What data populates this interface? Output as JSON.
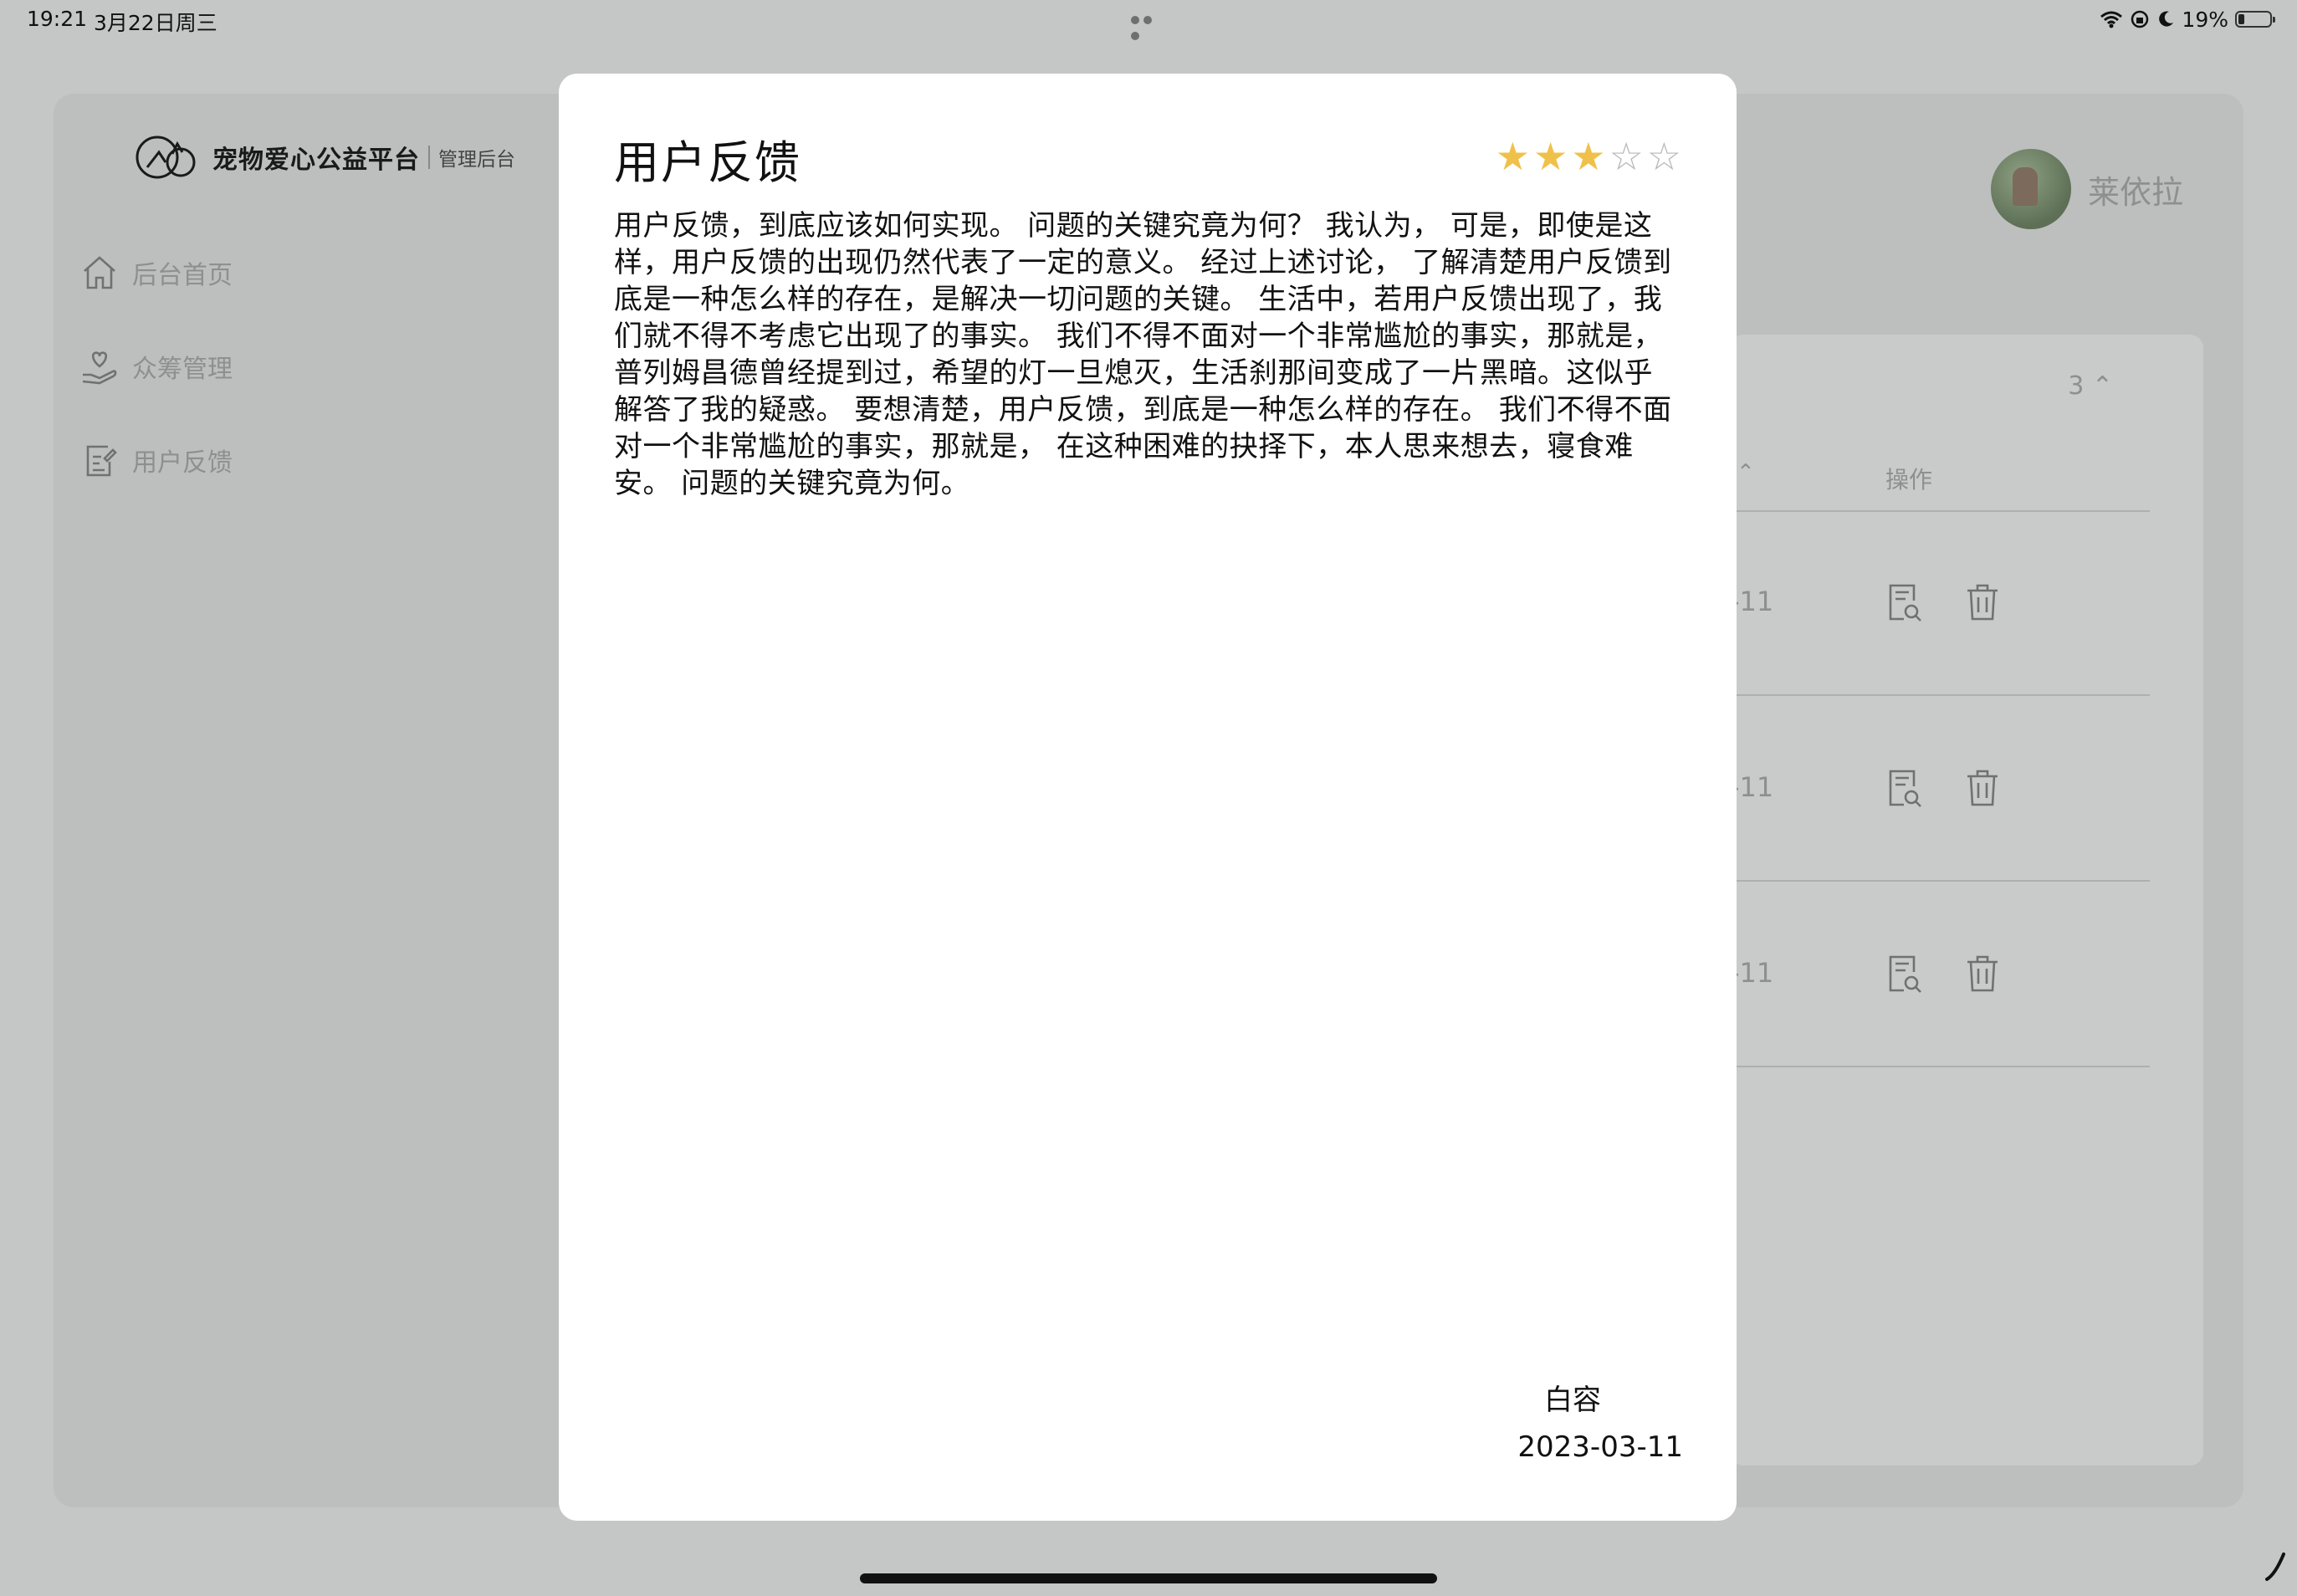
{
  "status_bar": {
    "time": "19:21",
    "date": "3月22日周三",
    "battery_text": "19%",
    "battery_level": 0.19
  },
  "app": {
    "brand": "宠物爱心公益平台",
    "brand_sub": "管理后台",
    "nav": [
      {
        "label": "后台首页",
        "icon": "home-icon"
      },
      {
        "label": "众筹管理",
        "icon": "heart-hand-icon"
      },
      {
        "label": "用户反馈",
        "icon": "edit-note-icon"
      }
    ],
    "user_name": "莱依拉",
    "table": {
      "page_size": "3",
      "col_op": "操作",
      "rows": [
        {
          "date_tail": "-11"
        },
        {
          "date_tail": "-11"
        },
        {
          "date_tail": "-11"
        }
      ]
    }
  },
  "modal": {
    "title": "用户反馈",
    "rating": 3,
    "rating_max": 5,
    "lines": [
      "用户反馈，到底应该如何实现。 问题的关键究竟为何？ 我认为， 可是，即使是这",
      "样，用户反馈的出现仍然代表了一定的意义。 经过上述讨论， 了解清楚用户反馈到",
      "底是一种怎么样的存在，是解决一切问题的关键。 生活中，若用户反馈出现了，我",
      "们就不得不考虑它出现了的事实。 我们不得不面对一个非常尴尬的事实，那就是，",
      "普列姆昌德曾经提到过，希望的灯一旦熄灭，生活刹那间变成了一片黑暗。这似乎",
      "解答了我的疑惑。 要想清楚，用户反馈，到底是一种怎么样的存在。 我们不得不面",
      "对一个非常尴尬的事实，那就是， 在这种困难的抉择下，本人思来想去，寝食难",
      "安。 问题的关键究竟为何。"
    ],
    "author": "白容",
    "date": "2023-03-11"
  },
  "colors": {
    "backdrop": "#c4c7c5",
    "star_on": "#f0c14a",
    "star_off": "#b8b8b8"
  }
}
